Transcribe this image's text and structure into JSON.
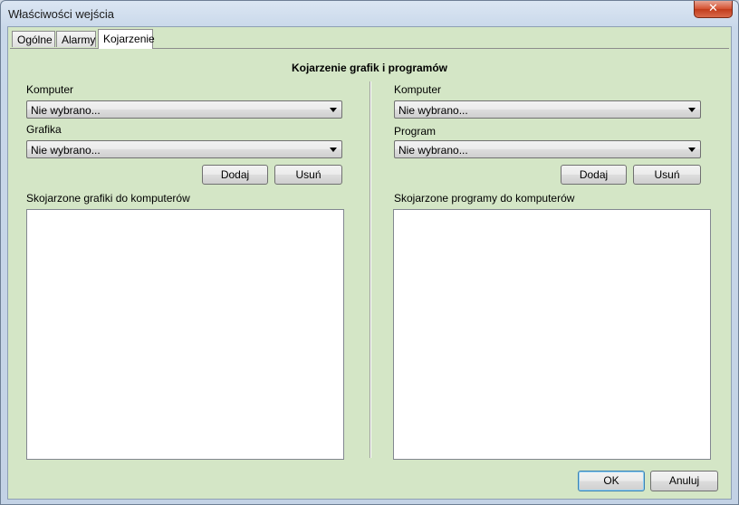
{
  "window": {
    "title": "Właściwości wejścia",
    "close_glyph": "✕"
  },
  "tabs": [
    {
      "label": "Ogólne"
    },
    {
      "label": "Alarmy"
    },
    {
      "label": "Kojarzenie"
    }
  ],
  "active_tab": "Kojarzenie",
  "panel": {
    "heading": "Kojarzenie grafik i programów",
    "left": {
      "computer_label": "Komputer",
      "computer_value": "Nie wybrano...",
      "graphic_label": "Grafika",
      "graphic_value": "Nie wybrano...",
      "add_label": "Dodaj",
      "remove_label": "Usuń",
      "list_label": "Skojarzone grafiki do komputerów",
      "list_items": []
    },
    "right": {
      "computer_label": "Komputer",
      "computer_value": "Nie wybrano...",
      "program_label": "Program",
      "program_value": "Nie wybrano...",
      "add_label": "Dodaj",
      "remove_label": "Usuń",
      "list_label": "Skojarzone programy do komputerów",
      "list_items": []
    }
  },
  "footer": {
    "ok_label": "OK",
    "cancel_label": "Anuluj"
  },
  "colors": {
    "panel_bg": "#d4e6c6",
    "close_button": "#d4502f"
  }
}
